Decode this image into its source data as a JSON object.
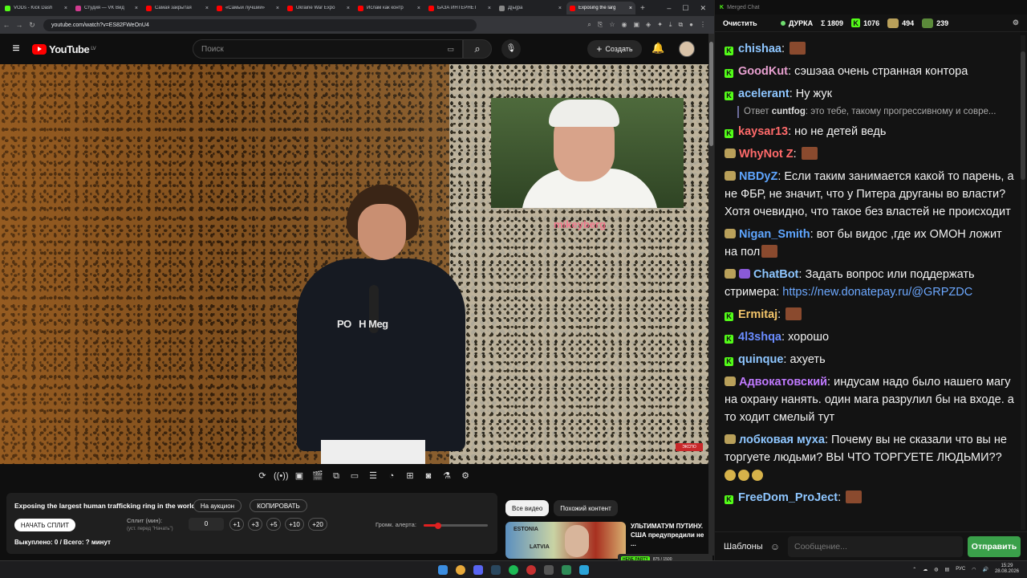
{
  "tabs": [
    {
      "title": "VODs - Kick Dash",
      "color": "#53fc18"
    },
    {
      "title": "Студия — VK Вид",
      "color": "#d23b8f"
    },
    {
      "title": "Самая закрытая",
      "color": "#ff0000"
    },
    {
      "title": "«Самый лучший»",
      "color": "#ff0000"
    },
    {
      "title": "Ukraine War Expo",
      "color": "#ff0000"
    },
    {
      "title": "Ислам как контр",
      "color": "#ff0000"
    },
    {
      "title": "БАЗА ИНТЕРНЕТ",
      "color": "#ff0000"
    },
    {
      "title": "Д[ы]ра",
      "color": "#888888"
    },
    {
      "title": "Exposing the larg",
      "color": "#ff0000"
    }
  ],
  "browser": {
    "url": "youtube.com/watch?v=ES82FWeOnU4",
    "new_tab": "+",
    "minimize": "–",
    "maximize": "☐",
    "close": "✕"
  },
  "youtube": {
    "logo": "YouTube",
    "region": "LV",
    "search_placeholder": "Поиск",
    "create_label": "Создать"
  },
  "video": {
    "pip_caption": "mikeyberg",
    "watermark": "ЭКСПО"
  },
  "panel": {
    "title": "Exposing the largest human trafficking ring in the world",
    "auction_label": "На аукцион",
    "copy_label": "КОПИРОВАТЬ",
    "start_split_label": "НАЧАТЬ СПЛИТ",
    "split_label": "Сплит (мин):",
    "split_hint": "(уст. перед \"Начать\")",
    "split_value": "0",
    "increments": [
      "+1",
      "+3",
      "+5",
      "+10",
      "+20"
    ],
    "alert_volume_label": "Громк. алерта:",
    "alert_volume": 0.22,
    "played_label": "Выкуплено: 0 / Всего: ? минут"
  },
  "recommend": {
    "chip_all": "Все видео",
    "chip_similar": "Похожий контент",
    "thumb_text_1": "ESTONIA",
    "thumb_text_2": "LATVIA",
    "title": "УЛЬТИМАТУМ ПУТИНУ. США предупредили не ..."
  },
  "kick_mini": {
    "label": "HENE PARTY",
    "value": "875 / 1500"
  },
  "chat": {
    "window_title": "Merged Chat",
    "clear_label": "Очистить",
    "channel": "ДУРКА",
    "sum_label": "Σ 1809",
    "kick_count": "1076",
    "other_count": "494",
    "third_count": "239",
    "messages": [
      {
        "badge": "kick",
        "user": "chishaa",
        "color": "#8ec6ff",
        "text": "",
        "emote": true
      },
      {
        "badge": "kick",
        "user": "GoodKut",
        "color": "#e8a0d0",
        "text": "сэшэаа очень странная контора"
      },
      {
        "badge": "kick",
        "user": "acelerant",
        "color": "#8ec6ff",
        "text": "Ну жук"
      },
      {
        "reply_user": "cuntfog",
        "reply_text": "это тебе, такому прогрессивному и совре...",
        "reply_prefix": "Ответ"
      },
      {
        "badge": "kick",
        "user": "kaysar13",
        "color": "#ff6a6a",
        "text": "но не детей ведь"
      },
      {
        "badge": "mod",
        "user": "WhyNot Z",
        "color": "#ff6a6a",
        "text": "",
        "emote": true
      },
      {
        "badge": "mod",
        "user": "NBDyZ",
        "color": "#5fa6ff",
        "text": "Если таким занимается какой то парень, а не ФБР, не значит, что у Питера друганы во власти? Хотя очевидно, что такое без властей не происходит"
      },
      {
        "badge": "mod",
        "user": "Nigan_Smith",
        "color": "#5fa6ff",
        "text": "вот бы видос ,где их ОМОН ложит на пол",
        "emote": true
      },
      {
        "badge": "mod",
        "user": "ChatBot",
        "color": "#8ec6ff",
        "text": "Задать вопрос или поддержать стримера:",
        "link": "https://new.donatepay.ru/@GRPZDC"
      },
      {
        "badge": "kick",
        "user": "Ermitaj",
        "color": "#f2c46a",
        "text": "",
        "emote": true
      },
      {
        "badge": "kick",
        "user": "4l3shqa",
        "color": "#6a8cff",
        "text": "хорошо"
      },
      {
        "badge": "kick",
        "user": "quinque",
        "color": "#8ec6ff",
        "text": "ахуеть"
      },
      {
        "badge": "mod",
        "user": "Адвокатовский",
        "color": "#c07aff",
        "text": "индусам надо было нашего магу на охрану нанять. один мага разрулил бы на входе. а то ходит смелый тут"
      },
      {
        "badge": "mod",
        "user": "лобковая муха",
        "color": "#8ec6ff",
        "text": "Почему вы не сказали что вы не торгуете людьми? ВЫ ЧТО ТОРГУЕТЕ ЛЮДЬМИ??",
        "laugh": true
      },
      {
        "badge": "kick",
        "user": "FreeDom_ProJect",
        "color": "#8ec6ff",
        "text": "",
        "emote": true
      }
    ],
    "templates_label": "Шаблоны",
    "input_placeholder": "Сообщение...",
    "send_label": "Отправить"
  },
  "taskbar": {
    "lang": "РУС",
    "time": "15:29",
    "date": "28.08.2026"
  }
}
